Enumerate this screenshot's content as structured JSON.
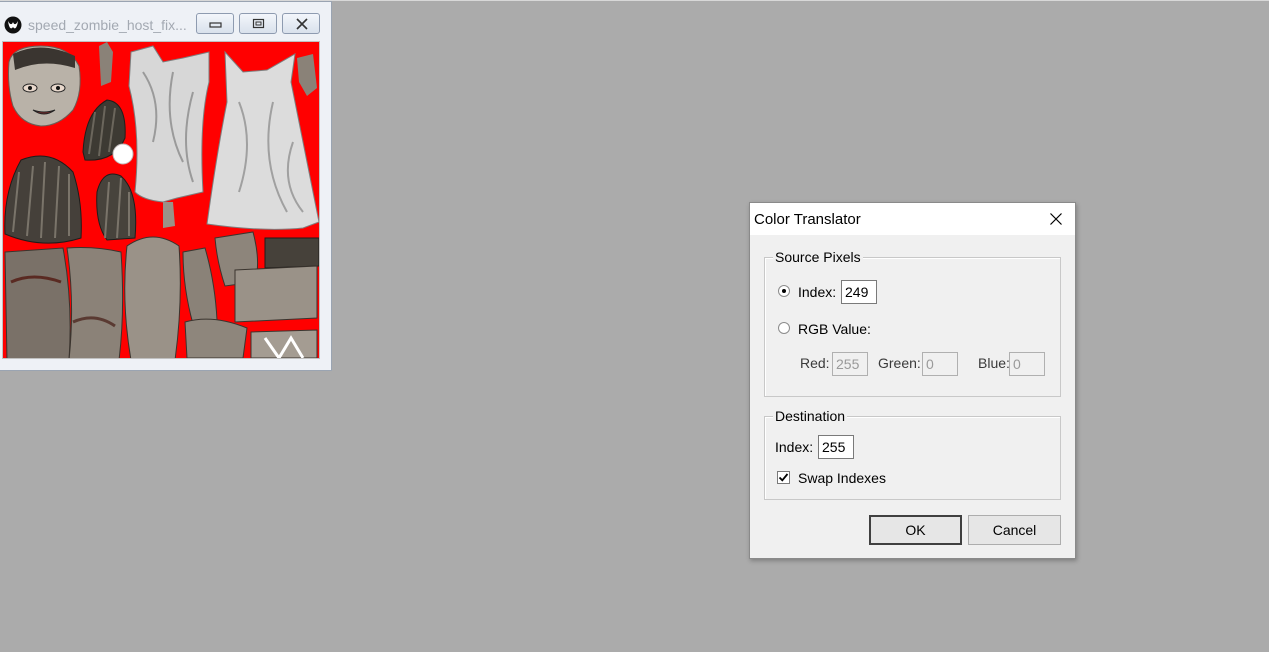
{
  "texture_window": {
    "title": "speed_zombie_host_fix...",
    "icon": "app-logo-icon",
    "buttons": [
      "minimize-icon",
      "restore-icon",
      "close-icon"
    ]
  },
  "dialog": {
    "title": "Color Translator",
    "source_pixels": {
      "legend": "Source Pixels",
      "index_label": "Index:",
      "index_value": "249",
      "rgb_label": "RGB Value:",
      "red_label": "Red:",
      "red_value": "255",
      "green_label": "Green:",
      "green_value": "0",
      "blue_label": "Blue:",
      "blue_value": "0",
      "selected": "index"
    },
    "destination": {
      "legend": "Destination",
      "index_label": "Index:",
      "index_value": "255",
      "swap_label": "Swap Indexes",
      "swap_checked": true
    },
    "ok_label": "OK",
    "cancel_label": "Cancel"
  },
  "colors": {
    "desktop": "#ababab",
    "texture_background": "#ff0000",
    "dialog_background": "#f0f0f0"
  }
}
